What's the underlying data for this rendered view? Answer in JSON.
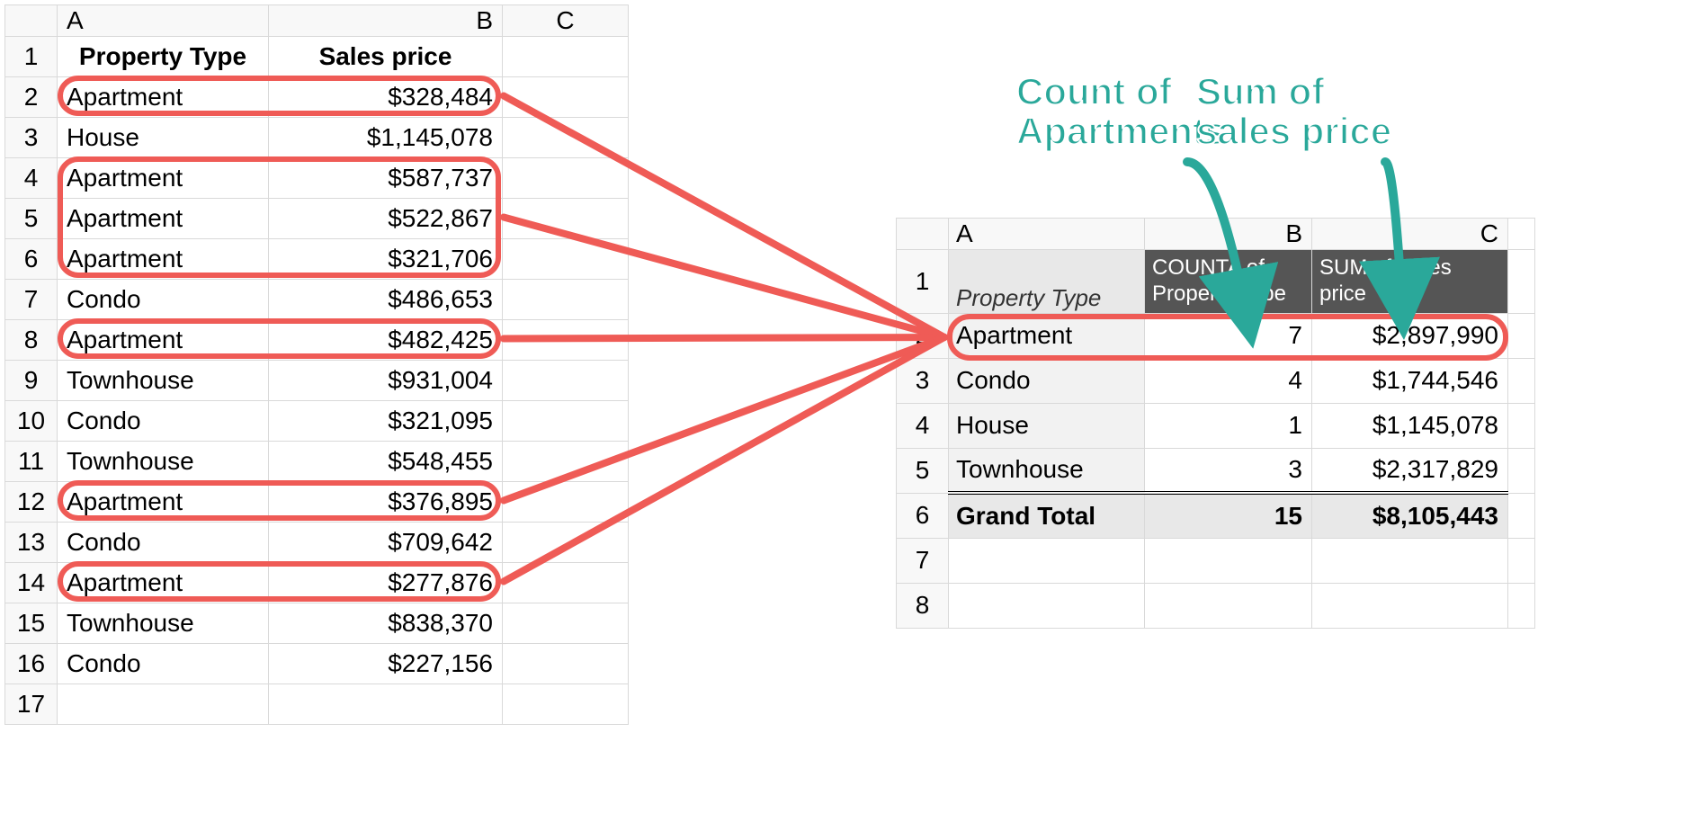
{
  "source": {
    "columns": [
      "A",
      "B",
      "C"
    ],
    "headers": {
      "A": "Property Type",
      "B": "Sales price"
    },
    "rows": [
      {
        "n": "1"
      },
      {
        "n": "2",
        "type": "Apartment",
        "price": "$328,484",
        "hl": true
      },
      {
        "n": "3",
        "type": "House",
        "price": "$1,145,078",
        "hl": false
      },
      {
        "n": "4",
        "type": "Apartment",
        "price": "$587,737",
        "hl": true
      },
      {
        "n": "5",
        "type": "Apartment",
        "price": "$522,867",
        "hl": true
      },
      {
        "n": "6",
        "type": "Apartment",
        "price": "$321,706",
        "hl": true
      },
      {
        "n": "7",
        "type": "Condo",
        "price": "$486,653",
        "hl": false
      },
      {
        "n": "8",
        "type": "Apartment",
        "price": "$482,425",
        "hl": true
      },
      {
        "n": "9",
        "type": "Townhouse",
        "price": "$931,004",
        "hl": false
      },
      {
        "n": "10",
        "type": "Condo",
        "price": "$321,095",
        "hl": false
      },
      {
        "n": "11",
        "type": "Townhouse",
        "price": "$548,455",
        "hl": false
      },
      {
        "n": "12",
        "type": "Apartment",
        "price": "$376,895",
        "hl": true
      },
      {
        "n": "13",
        "type": "Condo",
        "price": "$709,642",
        "hl": false
      },
      {
        "n": "14",
        "type": "Apartment",
        "price": "$277,876",
        "hl": true
      },
      {
        "n": "15",
        "type": "Townhouse",
        "price": "$838,370",
        "hl": false
      },
      {
        "n": "16",
        "type": "Condo",
        "price": "$227,156",
        "hl": false
      },
      {
        "n": "17"
      }
    ]
  },
  "pivot": {
    "columns": [
      "A",
      "B",
      "C"
    ],
    "header_rowlabel": "Property Type",
    "header_count": "COUNTA of Property Type",
    "header_sum": "SUM of Sales price",
    "rows": [
      {
        "n": "2",
        "label": "Apartment",
        "count": "7",
        "sum": "$2,897,990",
        "hl": true
      },
      {
        "n": "3",
        "label": "Condo",
        "count": "4",
        "sum": "$1,744,546"
      },
      {
        "n": "4",
        "label": "House",
        "count": "1",
        "sum": "$1,145,078"
      },
      {
        "n": "5",
        "label": "Townhouse",
        "count": "3",
        "sum": "$2,317,829"
      }
    ],
    "grand_total": {
      "n": "6",
      "label": "Grand Total",
      "count": "15",
      "sum": "$8,105,443"
    },
    "empty_rows": [
      "7",
      "8"
    ]
  },
  "annotations": {
    "count_label_l1": "Count of",
    "count_label_l2": "Apartments",
    "sum_label_l1": "Sum of",
    "sum_label_l2": "sales price"
  },
  "colors": {
    "highlight": "#ef5b56",
    "annotation": "#2aa89a"
  }
}
